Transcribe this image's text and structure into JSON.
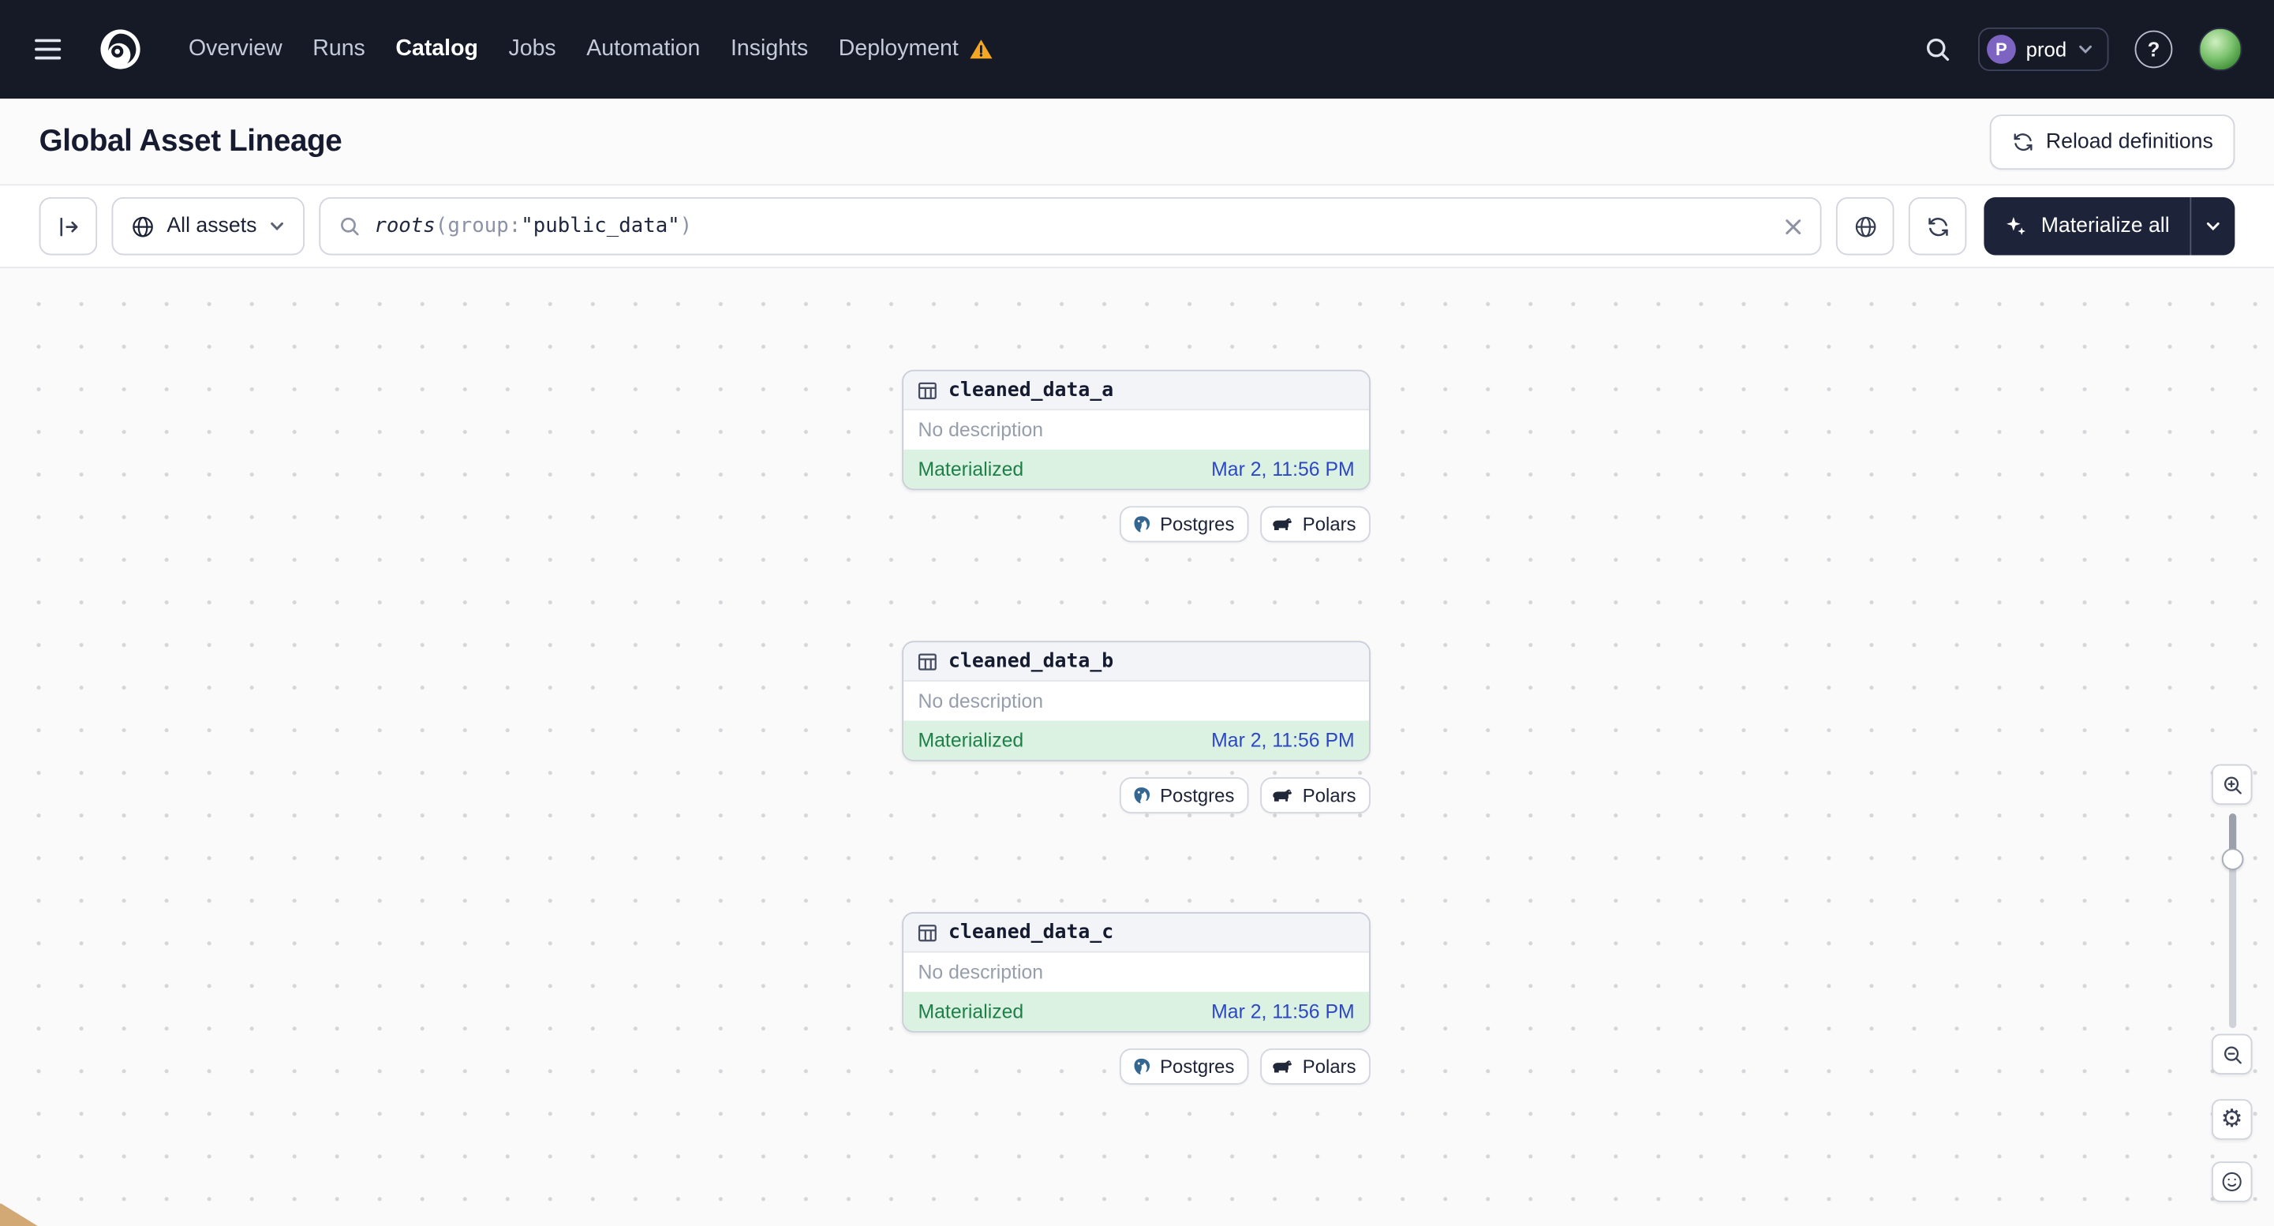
{
  "nav": {
    "items": [
      "Overview",
      "Runs",
      "Catalog",
      "Jobs",
      "Automation",
      "Insights",
      "Deployment"
    ],
    "active_item": "Catalog",
    "deployment_has_warning": true,
    "env": {
      "initial": "P",
      "name": "prod"
    }
  },
  "header": {
    "title": "Global Asset Lineage",
    "reload_label": "Reload definitions"
  },
  "toolbar": {
    "filter_label": "All assets",
    "query_fn": "roots",
    "query_open": "(",
    "query_key": "group:",
    "query_string": "\"public_data\"",
    "query_close": ")",
    "materialize_label": "Materialize all"
  },
  "nodes": [
    {
      "name": "cleaned_data_a",
      "description": "No description",
      "status": "Materialized",
      "timestamp": "Mar 2, 11:56 PM",
      "tags": [
        "Postgres",
        "Polars"
      ]
    },
    {
      "name": "cleaned_data_b",
      "description": "No description",
      "status": "Materialized",
      "timestamp": "Mar 2, 11:56 PM",
      "tags": [
        "Postgres",
        "Polars"
      ]
    },
    {
      "name": "cleaned_data_c",
      "description": "No description",
      "status": "Materialized",
      "timestamp": "Mar 2, 11:56 PM",
      "tags": [
        "Postgres",
        "Polars"
      ]
    }
  ],
  "icons": {
    "gear_glyph": "⚙",
    "help_glyph": "?"
  },
  "colors": {
    "nav_bg": "#161a27",
    "warning": "#f5a623",
    "materialized_bg": "#dbf2e2",
    "materialized_text": "#1f7f48",
    "timestamp_text": "#2d47c5",
    "accent_button": "#1d2338",
    "postgres_blue": "#336791",
    "env_circle": "#7d64c3"
  }
}
